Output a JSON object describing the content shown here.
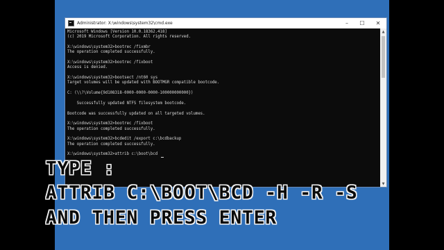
{
  "window": {
    "title": "Administrator: X:\\windows\\system32\\cmd.exe",
    "controls": {
      "minimize": "–",
      "maximize": "☐",
      "close": "✕"
    }
  },
  "console": {
    "lines": [
      "Microsoft Windows [Version 10.0.18362.418]",
      "(c) 2019 Microsoft Corporation. All rights reserved.",
      "",
      "X:\\windows\\system32>bootrec /fixmbr",
      "The operation completed successfully.",
      "",
      "X:\\windows\\system32>bootrec /fixboot",
      "Access is denied.",
      "",
      "X:\\windows\\system32>bootsect /nt60 sys",
      "Target volumes will be updated with BOOTMGR compatible bootcode.",
      "",
      "C: (\\\\?\\Volume{9d108318-0000-0000-0000-100000000000})",
      "",
      "    Successfully updated NTFS filesystem bootcode.",
      "",
      "Bootcode was successfully updated on all targeted volumes.",
      "",
      "X:\\windows\\system32>bootrec /fixboot",
      "The operation completed successfully.",
      "",
      "X:\\windows\\system32>bcdedit /export c:\\bcdbackup",
      "The operation completed successfully.",
      "",
      "X:\\windows\\system32>attrib c:\\boot\\bcd"
    ]
  },
  "caption": {
    "line1": "TYPE :",
    "line2": "ATTRIB C:\\BOOT\\BCD -H -R -S",
    "line3": "AND THEN PRESS ENTER"
  }
}
